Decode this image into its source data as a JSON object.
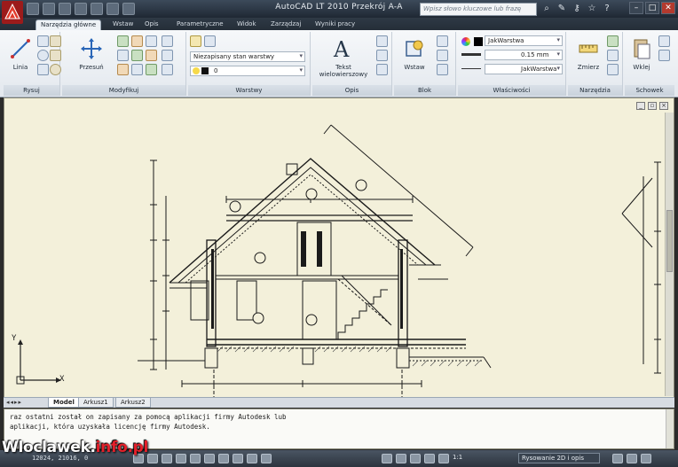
{
  "window": {
    "title": "AutoCAD LT 2010    Przekrój A-A",
    "search_placeholder": "Wpisz słowo kluczowe lub frazę"
  },
  "ribbon_tabs": [
    {
      "label": "Narzędzia główne",
      "active": true
    },
    {
      "label": "Wstaw",
      "active": false
    },
    {
      "label": "Opis",
      "active": false
    },
    {
      "label": "Parametryczne",
      "active": false
    },
    {
      "label": "Widok",
      "active": false
    },
    {
      "label": "Zarządzaj",
      "active": false
    },
    {
      "label": "Wyniki pracy",
      "active": false
    }
  ],
  "ribbon": {
    "rysuj": {
      "title": "Rysuj",
      "linia": "Linia"
    },
    "modyfikuj": {
      "title": "Modyfikuj",
      "przesun": "Przesuń"
    },
    "warstwy": {
      "title": "Warstwy",
      "layer_state": "Niezapisany stan warstwy",
      "current_layer": "0"
    },
    "opis": {
      "title": "Opis",
      "tekst": "Tekst wielowierszowy"
    },
    "blok": {
      "title": "Blok",
      "wstaw": "Wstaw"
    },
    "wlasciwosci": {
      "title": "Właściwości",
      "color": "JakWarstwa",
      "lineweight": "0.15 mm",
      "linetype": "JakWarstwa"
    },
    "narzedzia": {
      "title": "Narzędzia",
      "zmierz": "Zmierz"
    },
    "schowek": {
      "title": "Schowek",
      "wklej": "Wklej"
    }
  },
  "layout_tabs": [
    {
      "label": "Model",
      "active": true
    },
    {
      "label": "Arkusz1",
      "active": false
    },
    {
      "label": "Arkusz2",
      "active": false
    }
  ],
  "ucs": {
    "x": "X",
    "y": "Y"
  },
  "command_line": [
    "raz ostatni został on zapisany za pomocą aplikacji firmy Autodesk lub",
    "aplikacji, która uzyskała licencję firmy Autodesk."
  ],
  "status_bar": {
    "coordinates": "12024, 21016, 0",
    "annotation_scale": "1:1",
    "workspace": "Rysowanie 2D i opis"
  },
  "watermark": {
    "part1": "Wloclawek.",
    "part2": "info.pl"
  },
  "colors": {
    "canvas": "#f3f0da",
    "accent": "#e3202a"
  }
}
